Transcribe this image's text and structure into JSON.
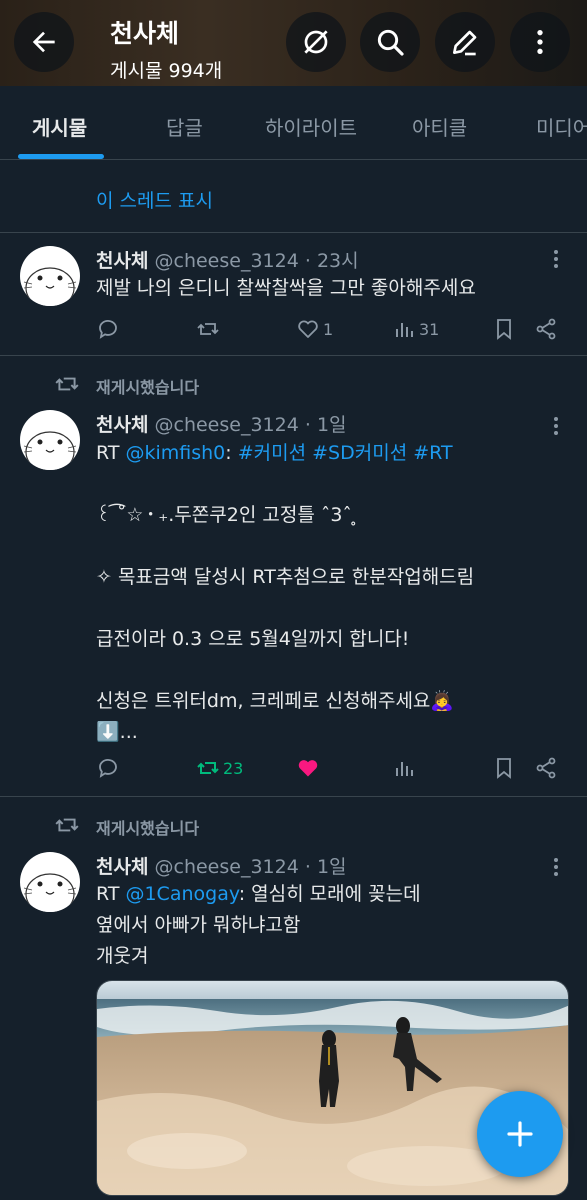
{
  "header": {
    "title": "천사체",
    "post_count": "게시물 994개",
    "back_icon": "arrow-left-icon",
    "buttons": [
      "mute-icon",
      "search-icon",
      "edit-icon",
      "more-icon"
    ]
  },
  "tabs": [
    {
      "label": "게시물",
      "active": true
    },
    {
      "label": "답글",
      "active": false
    },
    {
      "label": "하이라이트",
      "active": false
    },
    {
      "label": "아티클",
      "active": false
    },
    {
      "label": "미디어",
      "active": false
    }
  ],
  "show_thread": "이 스레드 표시",
  "tweets": [
    {
      "name": "천사체",
      "handle": "@cheese_3124",
      "time": "23시",
      "text": "제발 나의 은디니 찰싹찰싹을 그만 좋아해주세요",
      "replies": "",
      "retweets": "",
      "likes": "1",
      "views": "31"
    },
    {
      "retweeted_label": "재게시했습니다",
      "name": "천사체",
      "handle": "@cheese_3124",
      "time": "1일",
      "rt_prefix": "RT ",
      "mention": "@kimfish0",
      "colon": ": ",
      "hashtags": "#커미션 #SD커미션 #RT",
      "text": "꒰ ͡˚☆・₊.두쫀쿠2인 고정틀 ˆ3ˆ ̥\n\n✧ 목표금액 달성시 RT추첨으로 한분작업해드림\n\n급전이라 0.3 으로 5월4일까지 합니다!\n\n신청은 트위터dm, 크레페로 신청해주세요🙇‍♀️\n⬇️...",
      "retweets": "23",
      "liked": true
    },
    {
      "retweeted_label": "재게시했습니다",
      "name": "천사체",
      "handle": "@cheese_3124",
      "time": "1일",
      "rt_prefix": "RT ",
      "mention": "@1Canogay",
      "colon": ": ",
      "text_first": "열심히 모래에 꽂는데",
      "text_rest": "옆에서 아빠가 뭐하냐고함\n개웃겨"
    }
  ],
  "colors": {
    "background": "#15202b",
    "accent": "#1d9bf0",
    "retweet_green": "#00ba7c",
    "like_pink": "#f91880",
    "secondary_text": "#8b98a5"
  },
  "fab": {
    "icon": "plus-icon"
  }
}
